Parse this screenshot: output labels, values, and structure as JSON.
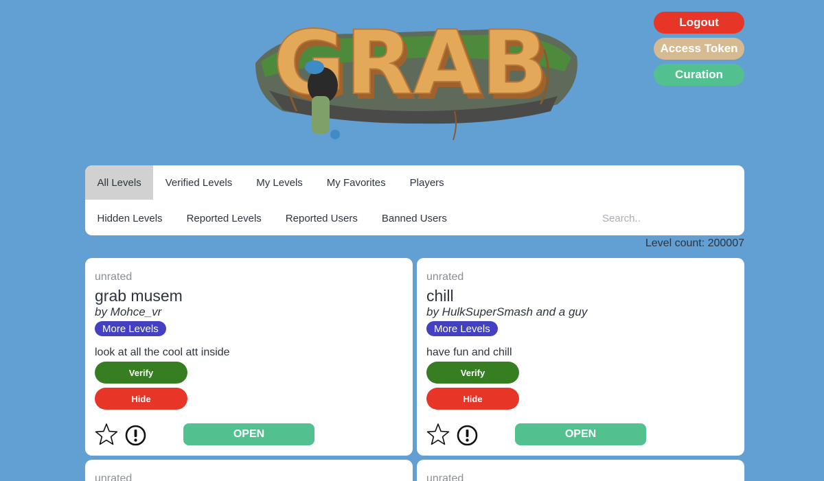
{
  "logo": {
    "text": "GRAB"
  },
  "header_buttons": {
    "logout": "Logout",
    "access_token": "Access Token",
    "curation": "Curation"
  },
  "nav": {
    "row1": [
      "All Levels",
      "Verified Levels",
      "My Levels",
      "My Favorites",
      "Players"
    ],
    "row2": [
      "Hidden Levels",
      "Reported Levels",
      "Reported Users",
      "Banned Users"
    ],
    "active_tab": "All Levels",
    "search_placeholder": "Search.."
  },
  "level_count": "Level count: 200007",
  "levels": [
    {
      "rating": "unrated",
      "title": "grab musem",
      "author": "by Mohce_vr",
      "more_label": "More Levels",
      "description": "look at all the cool att inside",
      "verify_label": "Verify",
      "hide_label": "Hide",
      "open_label": "OPEN",
      "favorite_icon": "star-outline-icon",
      "report_icon": "exclamation-circle-icon"
    },
    {
      "rating": "unrated",
      "title": "chill",
      "author": "by HulkSuperSmash and a guy",
      "more_label": "More Levels",
      "description": "have fun and chill",
      "verify_label": "Verify",
      "hide_label": "Hide",
      "open_label": "OPEN",
      "favorite_icon": "star-outline-icon",
      "report_icon": "exclamation-circle-icon"
    },
    {
      "rating": "unrated"
    },
    {
      "rating": "unrated"
    }
  ],
  "colors": {
    "background": "#629fd3",
    "logout": "#e73527",
    "access_token": "#d6bb92",
    "curation": "#52c18f",
    "more_levels": "#4340c2",
    "verify": "#377d22",
    "hide": "#e73527",
    "open": "#52c18f"
  }
}
